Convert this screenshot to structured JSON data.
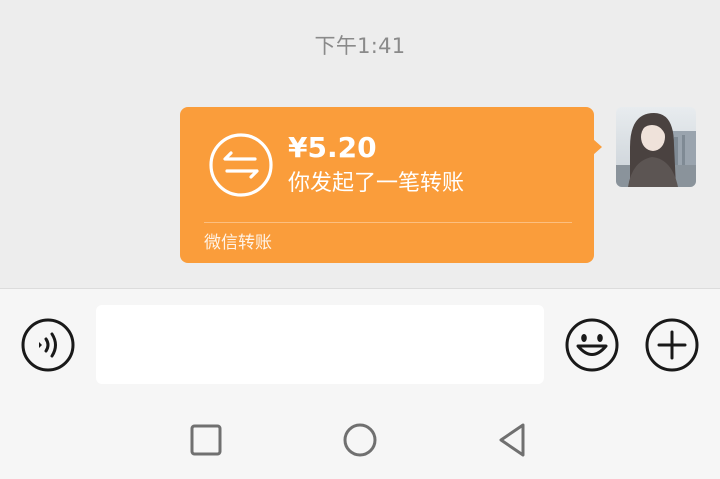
{
  "chat": {
    "timestamp": "下午1:41",
    "transfer": {
      "amount": "¥5.20",
      "description": "你发起了一笔转账",
      "footer": "微信转账",
      "color": "#fa9d3b"
    },
    "avatar": {
      "icon": "user-avatar"
    }
  },
  "input_bar": {
    "voice_icon": "voice-icon",
    "text_value": "",
    "emoji_icon": "emoji-icon",
    "plus_icon": "plus-icon"
  },
  "nav": {
    "recent_icon": "square-icon",
    "home_icon": "circle-icon",
    "back_icon": "triangle-back-icon"
  }
}
